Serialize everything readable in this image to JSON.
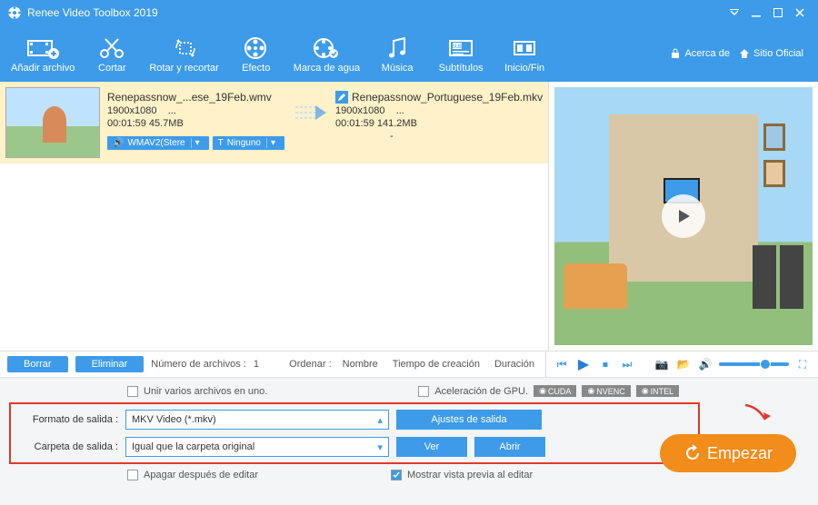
{
  "app": {
    "title": "Renee Video Toolbox 2019"
  },
  "toolbar": {
    "add": "Añadir archivo",
    "cut": "Cortar",
    "rotate": "Rotar y recortar",
    "effect": "Efecto",
    "watermark": "Marca de agua",
    "music": "Música",
    "subtitle": "Subtítulos",
    "startend": "Inicio/Fin",
    "about": "Acerca de",
    "site": "Sitio Oficial"
  },
  "file": {
    "src_name": "Renepassnow_...ese_19Feb.wmv",
    "src_res": "1900x1080",
    "src_dots": "...",
    "src_dur_size": "00:01:59  45.7MB",
    "audio_pill": "WMAV2(Stere",
    "sub_pill": "Ninguno",
    "out_name": "Renepassnow_Portuguese_19Feb.mkv",
    "out_res": "1900x1080",
    "out_dots": "...",
    "out_dur_size": "00:01:59  141.2MB",
    "out_extra": "-"
  },
  "mid": {
    "delete": "Borrar",
    "remove": "Eliminar",
    "count_label": "Número de archivos :",
    "count_value": "1",
    "sort_label": "Ordenar :",
    "sort_name": "Nombre",
    "sort_time": "Tiempo de creación",
    "sort_dur": "Duración"
  },
  "checks": {
    "merge": "Unir varios archivos en uno.",
    "gpu": "Aceleración de GPU.",
    "cuda": "CUDA",
    "nvenc": "NVENC",
    "intel": "INTEL",
    "shutdown": "Apagar después de editar",
    "preview": "Mostrar vista previa al editar"
  },
  "form": {
    "format_label": "Formato de salida :",
    "format_value": "MKV Video (*.mkv)",
    "settings": "Ajustes de salida",
    "folder_label": "Carpeta de salida :",
    "folder_value": "Igual que la carpeta original",
    "view": "Ver",
    "open": "Abrir"
  },
  "start": "Empezar"
}
